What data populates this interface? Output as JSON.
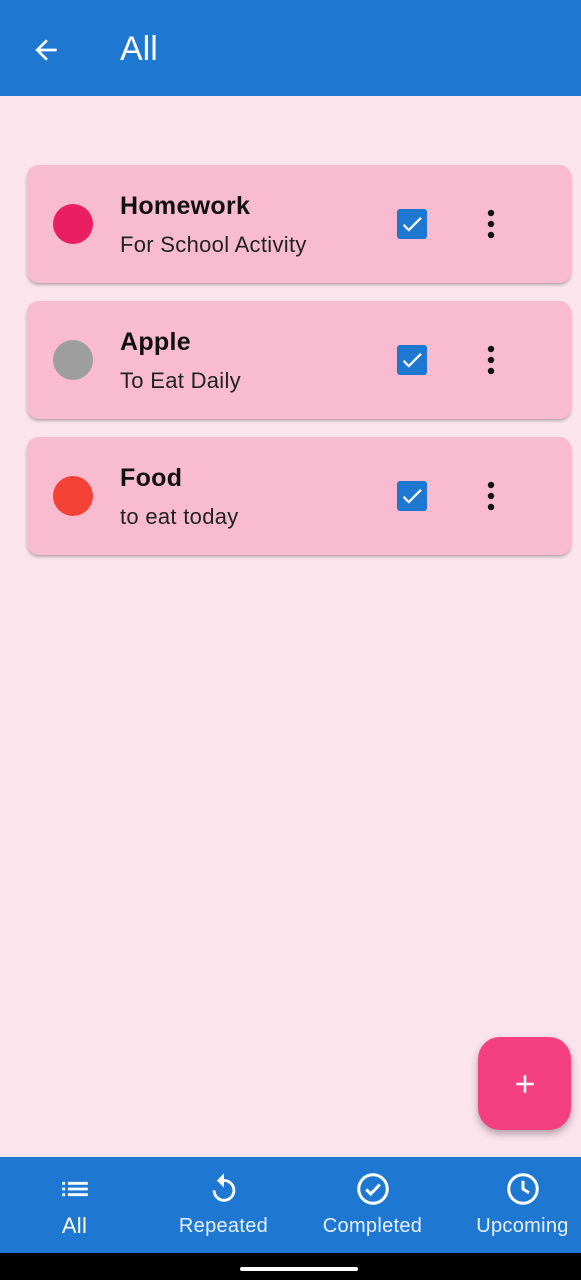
{
  "appbar": {
    "title": "All",
    "back_icon": "arrow-left-icon"
  },
  "tasks": [
    {
      "title": "Homework",
      "subtitle": "For School Activity",
      "color": "#e91e63",
      "checked": true
    },
    {
      "title": "Apple",
      "subtitle": "To Eat Daily",
      "color": "#9e9e9e",
      "checked": true
    },
    {
      "title": "Food",
      "subtitle": "to eat today",
      "color": "#f44336",
      "checked": true
    }
  ],
  "fab": {
    "icon": "plus-icon"
  },
  "bottom_nav": {
    "active": "All",
    "items": [
      {
        "label": "All",
        "icon": "list-icon"
      },
      {
        "label": "Repeated",
        "icon": "repeat-icon"
      },
      {
        "label": "Completed",
        "icon": "check-circle-icon"
      },
      {
        "label": "Upcoming",
        "icon": "clock-icon"
      }
    ]
  },
  "colors": {
    "primary": "#1e78d2",
    "background": "#fce4ec",
    "card": "#f8bbd0",
    "fab": "#f44081"
  }
}
